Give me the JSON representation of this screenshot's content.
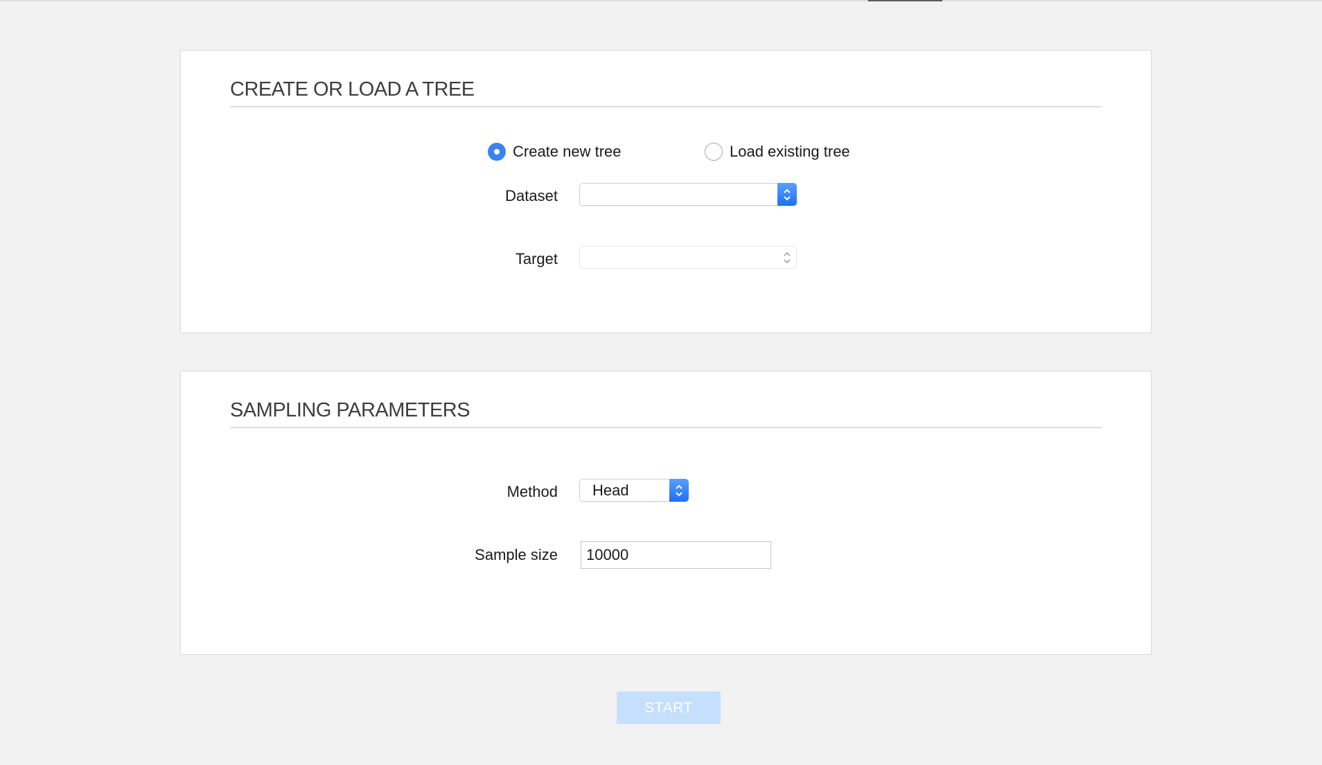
{
  "sections": {
    "tree": {
      "title": "CREATE OR LOAD A TREE",
      "mode_options": [
        {
          "label": "Create new tree",
          "selected": true
        },
        {
          "label": "Load existing tree",
          "selected": false
        }
      ],
      "dataset": {
        "label": "Dataset",
        "value": "",
        "icon": "updown-chevron-icon"
      },
      "target": {
        "label": "Target",
        "value": "",
        "icon": "updown-chevron-icon"
      }
    },
    "sampling": {
      "title": "SAMPLING PARAMETERS",
      "method": {
        "label": "Method",
        "value": "Head",
        "icon": "updown-chevron-icon"
      },
      "sample_size": {
        "label": "Sample size",
        "value": "10000"
      }
    }
  },
  "actions": {
    "start_label": "START"
  },
  "colors": {
    "accent": "#3b82f0",
    "start_disabled": "#c5dffd",
    "background": "#f2f2f2"
  }
}
